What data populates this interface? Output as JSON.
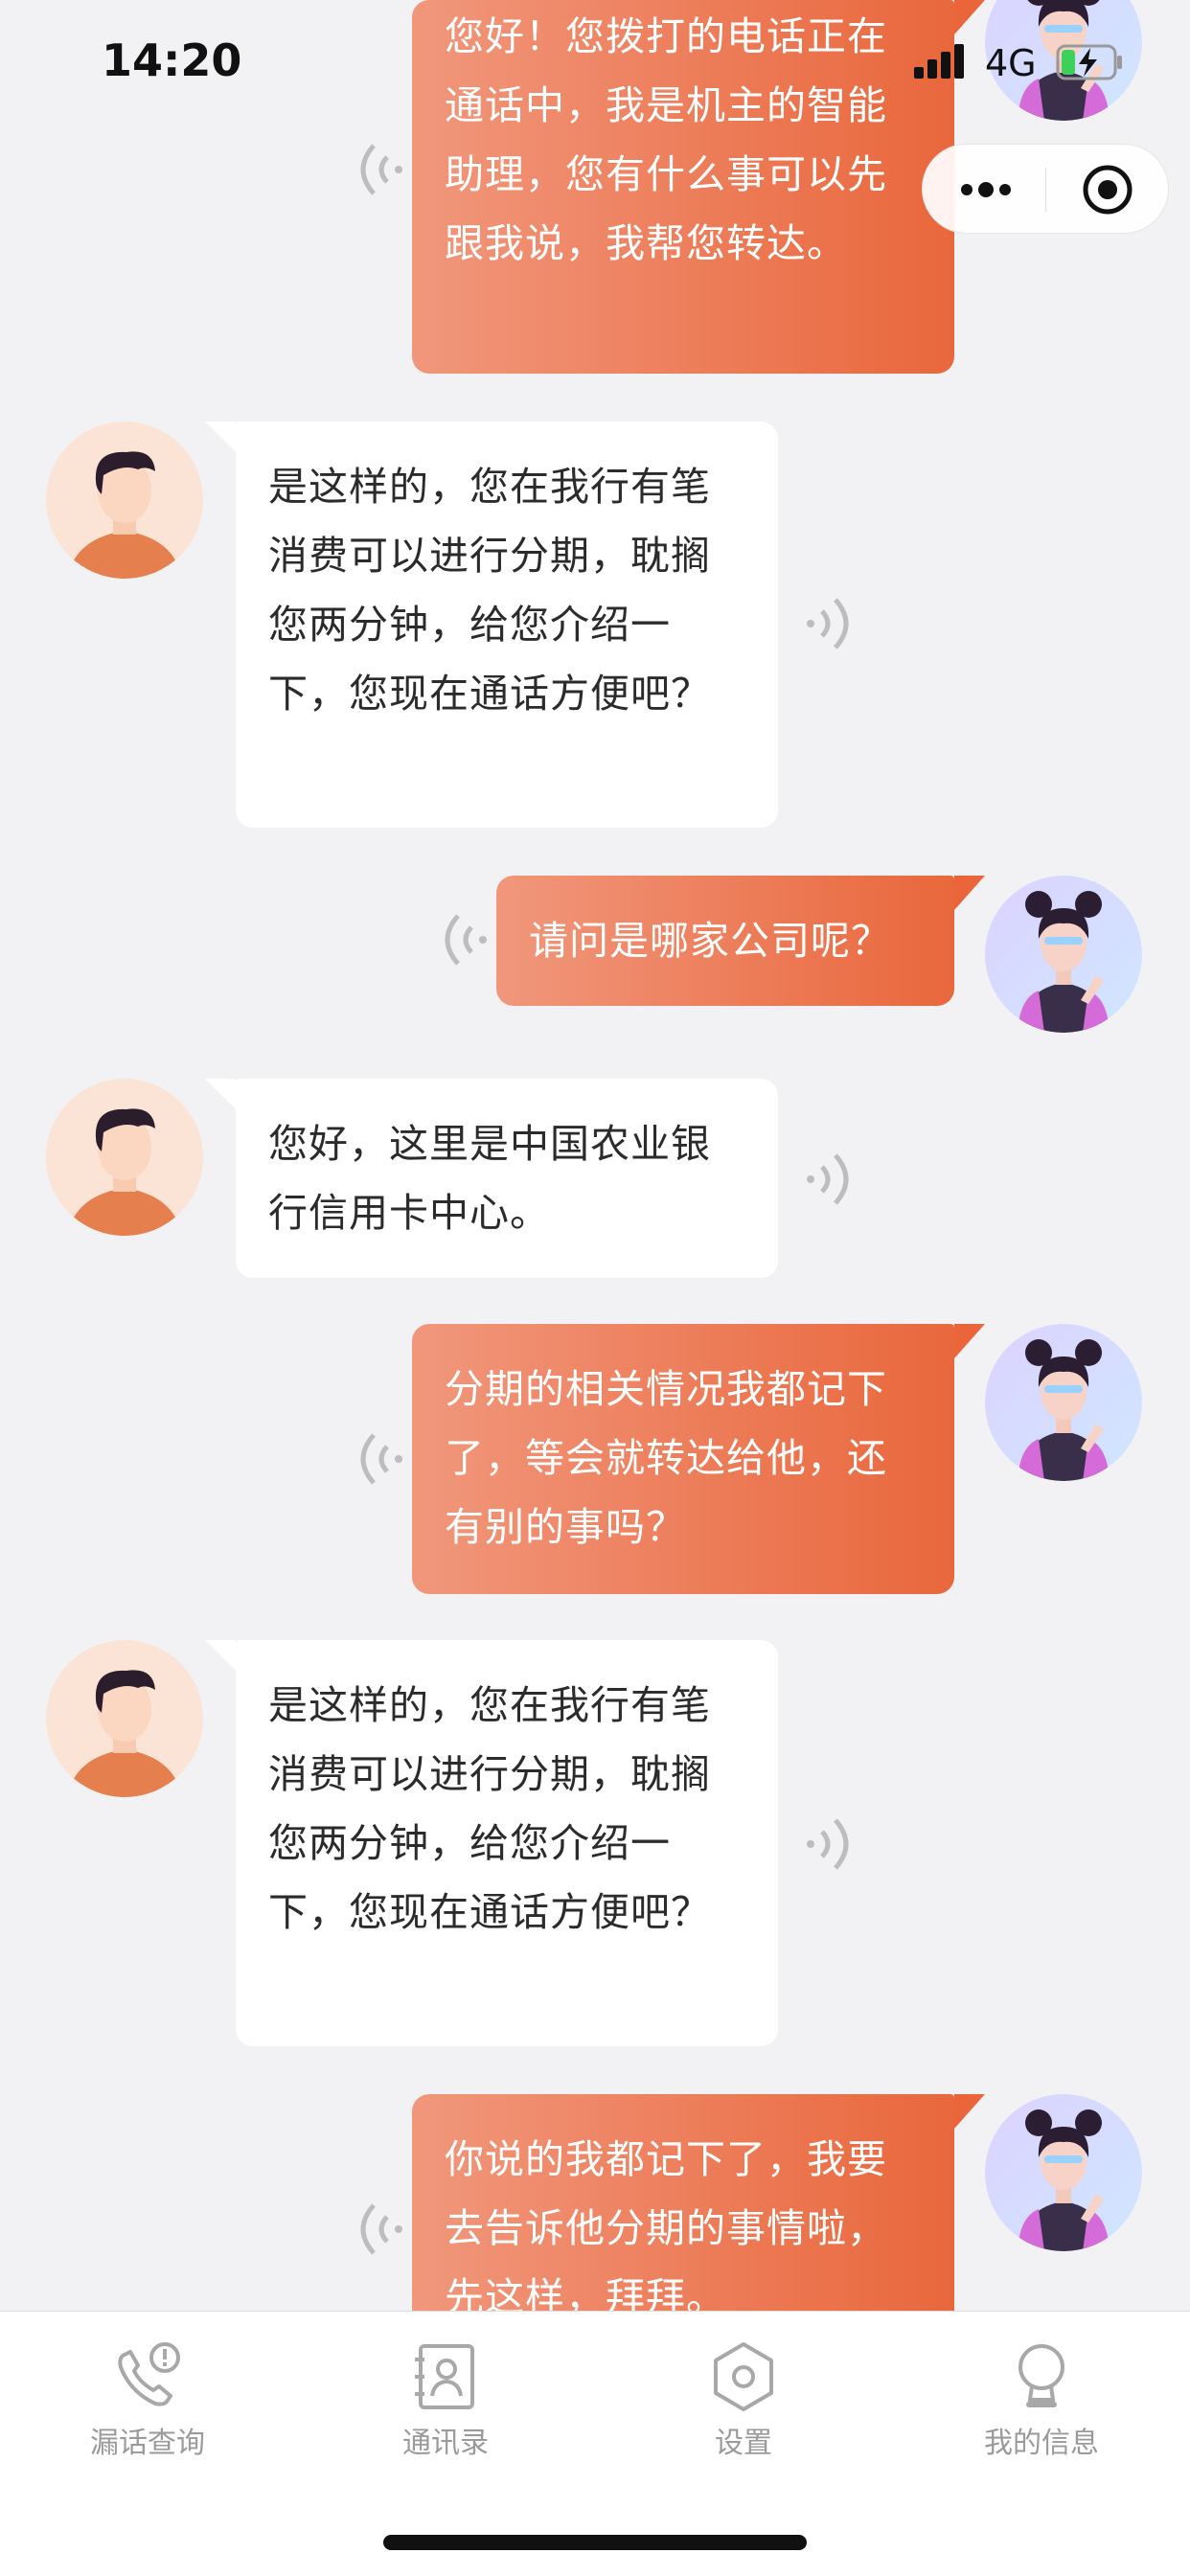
{
  "status_bar": {
    "time": "14:20",
    "network": "4G"
  },
  "messages": [
    {
      "side": "out",
      "text": "您好！您拨打的电话正在通话中，我是机主的智能助理，您有什么事可以先跟我说，我帮您转达。"
    },
    {
      "side": "in",
      "text": "是这样的，您在我行有笔消费可以进行分期，耽搁您两分钟，给您介绍一下，您现在通话方便吧？"
    },
    {
      "side": "out",
      "text": "请问是哪家公司呢？"
    },
    {
      "side": "in",
      "text": "您好，这里是中国农业银行信用卡中心。"
    },
    {
      "side": "out",
      "text": "分期的相关情况我都记下了，等会就转达给他，还有别的事吗？"
    },
    {
      "side": "in",
      "text": "是这样的，您在我行有笔消费可以进行分期，耽搁您两分钟，给您介绍一下，您现在通话方便吧？"
    },
    {
      "side": "out",
      "text": "你说的我都记下了，我要去告诉他分期的事情啦，先这样，拜拜。"
    }
  ],
  "tabs": [
    {
      "label": "漏话查询",
      "icon": "missed-call-icon"
    },
    {
      "label": "通讯录",
      "icon": "contacts-icon"
    },
    {
      "label": "设置",
      "icon": "settings-icon"
    },
    {
      "label": "我的信息",
      "icon": "profile-icon"
    }
  ],
  "colors": {
    "bubble_out_start": "#f1977c",
    "bubble_out_end": "#e9673c",
    "bubble_in": "#ffffff",
    "background": "#f2f2f4"
  }
}
